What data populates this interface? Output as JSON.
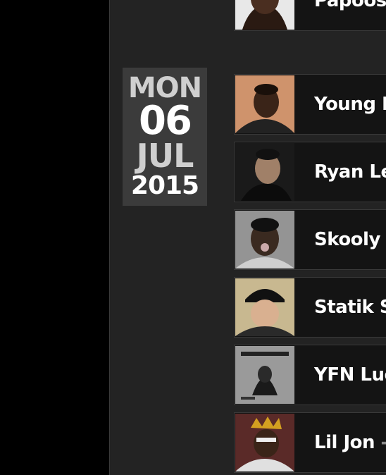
{
  "date": {
    "dow": "MON",
    "day": "06",
    "month": "JUL",
    "year": "2015"
  },
  "tracks": [
    {
      "title": "Papoose",
      "suffix": ""
    },
    {
      "title": "Young Do",
      "suffix": ""
    },
    {
      "title": "Ryan Les",
      "suffix": ""
    },
    {
      "title": "Skooly f",
      "suffix": ""
    },
    {
      "title": "Statik Sel",
      "suffix": ""
    },
    {
      "title": "YFN Lucc",
      "suffix": ""
    },
    {
      "title": "Lil Jon",
      "suffix": " -"
    }
  ],
  "colors": {
    "row_bg": "#141414",
    "panel_bg": "#232323",
    "date_bg": "#3b3b3b"
  }
}
